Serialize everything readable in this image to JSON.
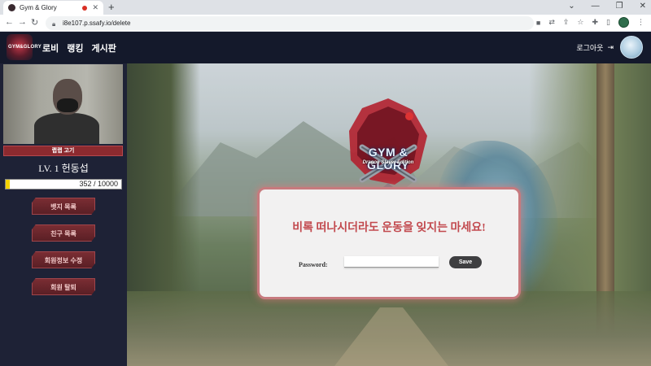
{
  "browser": {
    "tab_title": "Gym & Glory",
    "url": "i8e107.p.ssafy.io/delete"
  },
  "header": {
    "logo_text": "GYM&GLORY",
    "nav": [
      "로비",
      "랭킹",
      "게시판"
    ],
    "logout_label": "로그아웃",
    "logout_icon": "logout-icon"
  },
  "sidebar": {
    "nickname": "랩랩 고기",
    "level_label": "LV. 1 헌동섭",
    "exp_text": "352 / 10000",
    "exp_fraction": 0.0352,
    "buttons": [
      "뱃지 목록",
      "친구 목록",
      "회원정보 수정",
      "회원 탈퇴"
    ]
  },
  "emblem": {
    "title": "GYM & GLORY",
    "subtitle": "Dragon Slayer Edition"
  },
  "modal": {
    "message": "비록 떠나시더라도 운동을 잊지는 마세요!",
    "password_label": "Password:",
    "password_value": "",
    "save_label": "Save"
  },
  "colors": {
    "accent": "#c24a4f",
    "sidebar_button": "#6a262c",
    "header_bg": "#14192b"
  }
}
